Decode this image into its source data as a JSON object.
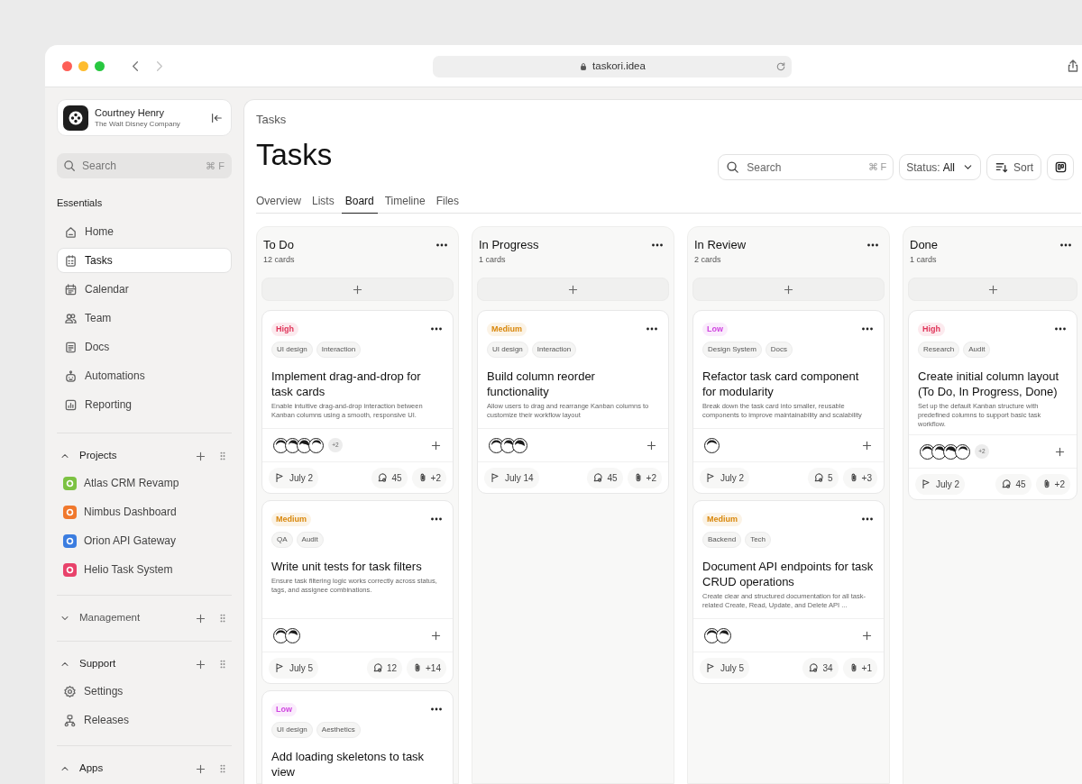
{
  "browser": {
    "url": "taskori.idea"
  },
  "sidebar": {
    "account": {
      "name": "Courtney Henry",
      "company": "The Walt Disney Company"
    },
    "search": {
      "placeholder": "Search",
      "shortcut": "⌘ F"
    },
    "essentials": {
      "title": "Essentials",
      "items": [
        {
          "label": "Home",
          "selected": false
        },
        {
          "label": "Tasks",
          "selected": true
        },
        {
          "label": "Calendar",
          "selected": false
        },
        {
          "label": "Team",
          "selected": false
        },
        {
          "label": "Docs",
          "selected": false
        },
        {
          "label": "Automations",
          "selected": false
        },
        {
          "label": "Reporting",
          "selected": false
        }
      ]
    },
    "groups": [
      {
        "title": "Projects",
        "expanded": true,
        "items": [
          {
            "label": "Atlas CRM Revamp",
            "color": "#7cc242"
          },
          {
            "label": "Nimbus Dashboard",
            "color": "#f0782d"
          },
          {
            "label": "Orion API Gateway",
            "color": "#3b7de0"
          },
          {
            "label": "Helio Task System",
            "color": "#e8426a"
          }
        ]
      },
      {
        "title": "Management",
        "expanded": false
      },
      {
        "title": "Support",
        "expanded": true,
        "items": [
          {
            "label": "Settings"
          },
          {
            "label": "Releases"
          }
        ]
      },
      {
        "title": "Apps",
        "expanded": true
      }
    ]
  },
  "main": {
    "breadcrumb": "Tasks",
    "title": "Tasks",
    "search": {
      "placeholder": "Search",
      "shortcut": "⌘ F"
    },
    "status_filter": {
      "label": "Status:",
      "value": "All"
    },
    "sort_button": "Sort",
    "tabs": [
      {
        "label": "Overview",
        "selected": false
      },
      {
        "label": "Lists",
        "selected": false
      },
      {
        "label": "Board",
        "selected": true
      },
      {
        "label": "Timeline",
        "selected": false
      },
      {
        "label": "Files",
        "selected": false
      }
    ],
    "columns": [
      {
        "title": "To Do",
        "count": "12 cards",
        "cards": [
          {
            "priority": {
              "label": "High",
              "color": "#e0355a"
            },
            "tags": [
              "UI design",
              "Interaction"
            ],
            "title": "Implement drag-and-drop for task cards",
            "description": "Enable intuitive drag-and-drop interaction between Kanban columns using a smooth, responsive UI.",
            "assignees": [
              {
                "kind": "avatar"
              },
              {
                "kind": "avatar"
              },
              {
                "kind": "avatar"
              },
              {
                "kind": "avatar"
              }
            ],
            "more_assignees": "+2",
            "due": "July 2",
            "comments": "45",
            "attachments": "+2"
          },
          {
            "priority": {
              "label": "Medium",
              "color": "#d9870b"
            },
            "tags": [
              "QA",
              "Audit"
            ],
            "title": "Write unit tests for task filters",
            "description": "Ensure task filtering logic works correctly across status, tags, and assignee combinations.",
            "assignees": [
              {
                "kind": "avatar"
              },
              {
                "kind": "avatar"
              }
            ],
            "due": "July 5",
            "comments": "12",
            "attachments": "+14"
          },
          {
            "priority": {
              "label": "Low",
              "color": "#d046e0"
            },
            "tags": [
              "UI design",
              "Aesthetics"
            ],
            "title": "Add loading skeletons to task view"
          }
        ]
      },
      {
        "title": "In Progress",
        "count": "1 cards",
        "cards": [
          {
            "priority": {
              "label": "Medium",
              "color": "#d9870b"
            },
            "tags": [
              "UI design",
              "Interaction"
            ],
            "title": "Build column reorder functionality",
            "description": "Allow users to drag and rearrange Kanban columns to customize their workflow layout",
            "assignees": [
              {
                "kind": "avatar"
              },
              {
                "kind": "avatar"
              },
              {
                "kind": "avatar"
              }
            ],
            "due": "July 14",
            "comments": "45",
            "attachments": "+2"
          }
        ]
      },
      {
        "title": "In Review",
        "count": "2 cards",
        "cards": [
          {
            "priority": {
              "label": "Low",
              "color": "#d046e0"
            },
            "tags": [
              "Design System",
              "Docs"
            ],
            "title": "Refactor task card component for modularity",
            "description": "Break down the task card into smaller, reusable components to improve maintainability and scalability",
            "assignees": [
              {
                "kind": "avatar"
              }
            ],
            "due": "July 2",
            "comments": "5",
            "attachments": "+3"
          },
          {
            "priority": {
              "label": "Medium",
              "color": "#d9870b"
            },
            "tags": [
              "Backend",
              "Tech"
            ],
            "title": "Document API endpoints for task CRUD operations",
            "description": "Create clear and structured documentation for all task-related Create, Read, Update, and Delete API ...",
            "assignees": [
              {
                "kind": "avatar"
              },
              {
                "kind": "avatar"
              }
            ],
            "due": "July 5",
            "comments": "34",
            "attachments": "+1"
          }
        ]
      },
      {
        "title": "Done",
        "count": "1 cards",
        "cards": [
          {
            "priority": {
              "label": "High",
              "color": "#e0355a"
            },
            "tags": [
              "Research",
              "Audit"
            ],
            "title": "Create initial column layout (To Do, In Progress, Done)",
            "description": "Set up the default Kanban structure with predefined columns to support basic task workflow.",
            "assignees": [
              {
                "kind": "avatar"
              },
              {
                "kind": "avatar"
              },
              {
                "kind": "avatar"
              },
              {
                "kind": "avatar"
              }
            ],
            "more_assignees": "+2",
            "due": "July 2",
            "comments": "45",
            "attachments": "+2"
          }
        ]
      }
    ]
  }
}
